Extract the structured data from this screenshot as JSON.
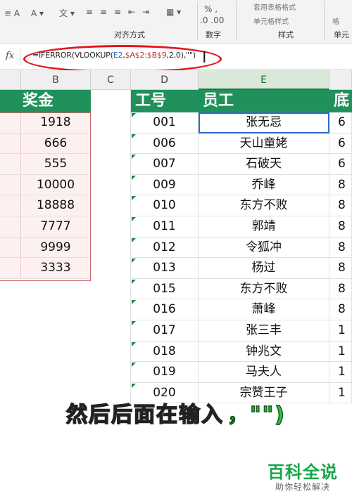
{
  "ribbon": {
    "groups": [
      "对齐方式",
      "数字",
      "样式",
      "单元"
    ],
    "style_items": [
      "套用表格格式",
      "单元格样式"
    ],
    "misc": [
      "格"
    ]
  },
  "formula_bar": {
    "fx_label": "fx",
    "formula_parts": [
      "=IFERROR(VLOOKUP(",
      "E2",
      ",",
      "$A$2:$B$9",
      ",2,0),\"\")"
    ]
  },
  "columns": [
    "B",
    "C",
    "D",
    "E"
  ],
  "table_left": {
    "header": "奖金",
    "values": [
      "1918",
      "666",
      "555",
      "10000",
      "18888",
      "7777",
      "9999",
      "3333"
    ]
  },
  "table_right": {
    "headers": {
      "id": "工号",
      "name": "员工",
      "extra": "底"
    },
    "rows": [
      {
        "id": "001",
        "name": "张无忌",
        "extra": "6"
      },
      {
        "id": "006",
        "name": "天山童姥",
        "extra": "6"
      },
      {
        "id": "007",
        "name": "石破天",
        "extra": "6"
      },
      {
        "id": "009",
        "name": "乔峰",
        "extra": "8"
      },
      {
        "id": "010",
        "name": "东方不败",
        "extra": "8"
      },
      {
        "id": "011",
        "name": "郭靖",
        "extra": "8"
      },
      {
        "id": "012",
        "name": "令狐冲",
        "extra": "8"
      },
      {
        "id": "013",
        "name": "杨过",
        "extra": "8"
      },
      {
        "id": "015",
        "name": "东方不败",
        "extra": "8"
      },
      {
        "id": "016",
        "name": "萧峰",
        "extra": "8"
      },
      {
        "id": "017",
        "name": "张三丰",
        "extra": "1"
      },
      {
        "id": "018",
        "name": "钟兆文",
        "extra": "1"
      },
      {
        "id": "019",
        "name": "马夫人",
        "extra": "1"
      },
      {
        "id": "020",
        "name": "宗赞王子",
        "extra": "1"
      }
    ]
  },
  "subtitle": {
    "text": "然后后面在输入",
    "quotes": "，\"\")"
  },
  "watermark": {
    "main": "百科全说",
    "sub": "助你轻松解决"
  },
  "colors": {
    "header_green": "#21915b",
    "ellipse_red": "#e2161a",
    "active_blue": "#2f6ad0"
  }
}
